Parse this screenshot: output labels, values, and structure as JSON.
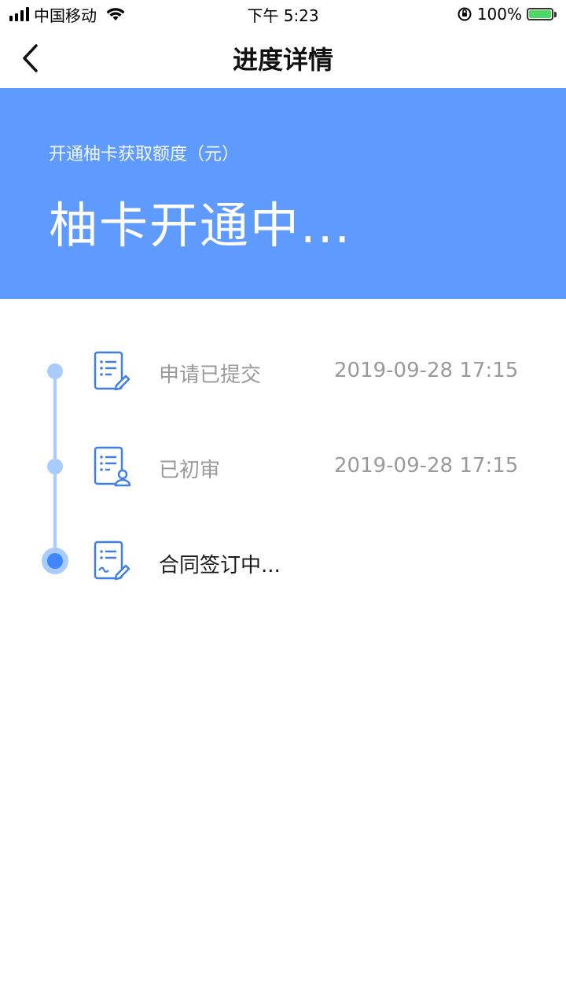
{
  "status_bar": {
    "carrier": "中国移动",
    "time": "下午 5:23",
    "battery_percent": "100%",
    "signal_icon": "signal-bars-icon",
    "wifi_icon": "wifi-icon",
    "orientation_icon": "orientation-lock-icon",
    "battery_icon": "battery-charging-icon"
  },
  "nav": {
    "back_icon": "chevron-left-icon",
    "title": "进度详情"
  },
  "banner": {
    "subtitle": "开通柚卡获取额度（元）",
    "status": "柚卡开通中...",
    "background_color": "#5f9bff"
  },
  "timeline": {
    "line_color": "#a9ccff",
    "active_color": "#3f86ff",
    "steps": [
      {
        "label": "申请已提交",
        "time": "2019-09-28 17:15",
        "icon": "document-edit-icon",
        "state": "done"
      },
      {
        "label": "已初审",
        "time": "2019-09-28 17:15",
        "icon": "document-user-icon",
        "state": "done"
      },
      {
        "label": "合同签订中...",
        "time": "",
        "icon": "document-sign-icon",
        "state": "current"
      }
    ]
  }
}
